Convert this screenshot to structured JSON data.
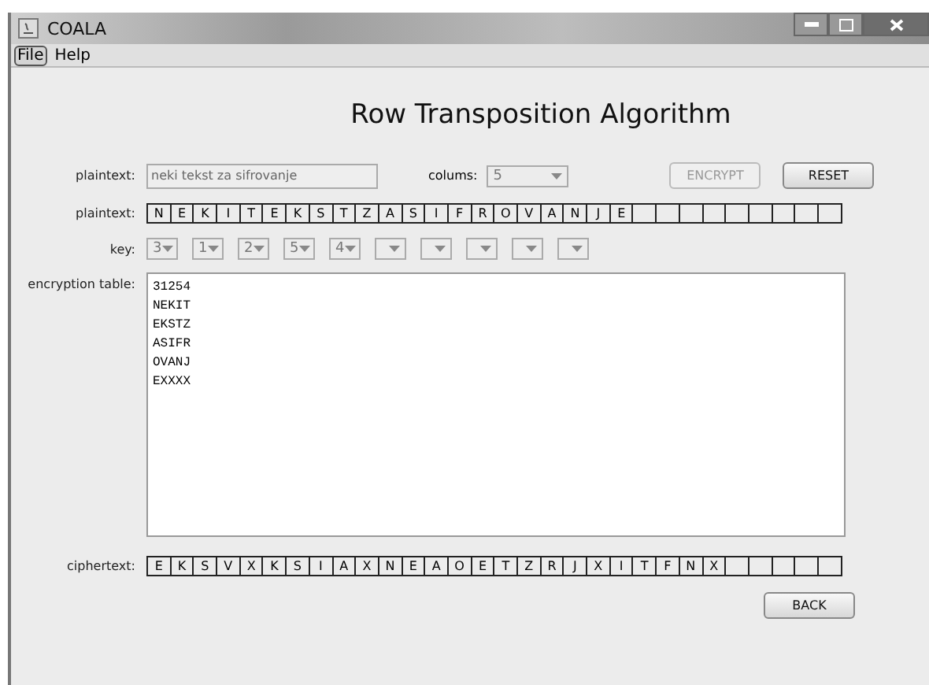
{
  "window": {
    "title": "COALA"
  },
  "menu": [
    {
      "label": "File",
      "selected": true
    },
    {
      "label": "Help",
      "selected": false
    }
  ],
  "heading": "Row Transposition Algorithm",
  "input_row": {
    "label": "plaintext:",
    "field": {
      "value": "neki tekst za sifrovanje",
      "disabled": true
    },
    "columns_label": "colums:",
    "columns": {
      "value": "5",
      "disabled": true
    },
    "buttons": [
      {
        "label": "ENCRYPT",
        "disabled": true
      },
      {
        "label": "RESET",
        "disabled": false
      }
    ]
  },
  "plaintext_cells": {
    "label": "plaintext:",
    "cells": [
      {
        "kind": "letter",
        "value": "N"
      },
      {
        "kind": "letter",
        "value": "E"
      },
      {
        "kind": "letter",
        "value": "K"
      },
      {
        "kind": "letter",
        "value": "I"
      },
      {
        "kind": "letter",
        "value": "T"
      },
      {
        "kind": "letter",
        "value": "E"
      },
      {
        "kind": "letter",
        "value": "K"
      },
      {
        "kind": "letter",
        "value": "S"
      },
      {
        "kind": "letter",
        "value": "T"
      },
      {
        "kind": "letter",
        "value": "Z"
      },
      {
        "kind": "letter",
        "value": "A"
      },
      {
        "kind": "letter",
        "value": "S"
      },
      {
        "kind": "letter",
        "value": "I"
      },
      {
        "kind": "letter",
        "value": "F"
      },
      {
        "kind": "letter",
        "value": "R"
      },
      {
        "kind": "letter",
        "value": "O"
      },
      {
        "kind": "letter",
        "value": "V"
      },
      {
        "kind": "letter",
        "value": "A"
      },
      {
        "kind": "letter",
        "value": "N"
      },
      {
        "kind": "letter",
        "value": "J"
      },
      {
        "kind": "letter",
        "value": "E"
      },
      {
        "kind": "empty"
      },
      {
        "kind": "empty"
      },
      {
        "kind": "empty"
      },
      {
        "kind": "empty"
      },
      {
        "kind": "empty"
      },
      {
        "kind": "empty"
      },
      {
        "kind": "empty"
      },
      {
        "kind": "empty"
      },
      {
        "kind": "empty"
      }
    ]
  },
  "key": {
    "label": "key:",
    "selects": [
      {
        "kind": "value",
        "value": "3",
        "disabled": true
      },
      {
        "kind": "value",
        "value": "1",
        "disabled": true
      },
      {
        "kind": "value",
        "value": "2",
        "disabled": true
      },
      {
        "kind": "value",
        "value": "5",
        "disabled": true
      },
      {
        "kind": "value",
        "value": "4",
        "disabled": true
      },
      {
        "kind": "empty",
        "disabled": true
      },
      {
        "kind": "empty",
        "disabled": true
      },
      {
        "kind": "empty",
        "disabled": true
      },
      {
        "kind": "empty",
        "disabled": true
      },
      {
        "kind": "empty",
        "disabled": true
      }
    ]
  },
  "encryption_table": {
    "label": "encryption table:",
    "lines": [
      "31254",
      "NEKIT",
      "EKSTZ",
      "ASIFR",
      "OVANJ",
      "EXXXX"
    ]
  },
  "ciphertext_cells": {
    "label": "ciphertext:",
    "cells": [
      {
        "kind": "letter",
        "value": "E"
      },
      {
        "kind": "letter",
        "value": "K"
      },
      {
        "kind": "letter",
        "value": "S"
      },
      {
        "kind": "letter",
        "value": "V"
      },
      {
        "kind": "letter",
        "value": "X"
      },
      {
        "kind": "letter",
        "value": "K"
      },
      {
        "kind": "letter",
        "value": "S"
      },
      {
        "kind": "letter",
        "value": "I"
      },
      {
        "kind": "letter",
        "value": "A"
      },
      {
        "kind": "letter",
        "value": "X"
      },
      {
        "kind": "letter",
        "value": "N"
      },
      {
        "kind": "letter",
        "value": "E"
      },
      {
        "kind": "letter",
        "value": "A"
      },
      {
        "kind": "letter",
        "value": "O"
      },
      {
        "kind": "letter",
        "value": "E"
      },
      {
        "kind": "letter",
        "value": "T"
      },
      {
        "kind": "letter",
        "value": "Z"
      },
      {
        "kind": "letter",
        "value": "R"
      },
      {
        "kind": "letter",
        "value": "J"
      },
      {
        "kind": "letter",
        "value": "X"
      },
      {
        "kind": "letter",
        "value": "I"
      },
      {
        "kind": "letter",
        "value": "T"
      },
      {
        "kind": "letter",
        "value": "F"
      },
      {
        "kind": "letter",
        "value": "N"
      },
      {
        "kind": "letter",
        "value": "X"
      },
      {
        "kind": "empty"
      },
      {
        "kind": "empty"
      },
      {
        "kind": "empty"
      },
      {
        "kind": "empty"
      },
      {
        "kind": "empty"
      }
    ]
  },
  "back_button": {
    "label": "BACK"
  }
}
